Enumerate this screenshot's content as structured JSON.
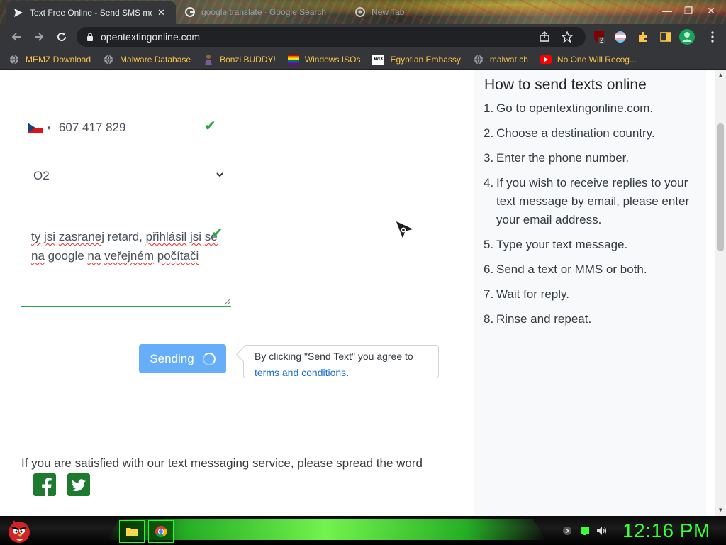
{
  "browser": {
    "tabs": [
      {
        "title": "Text Free Online - Send SMS me",
        "favicon": "paper-plane-icon",
        "active": true
      },
      {
        "title": "google translate - Google Search",
        "favicon": "google-icon",
        "active": false
      },
      {
        "title": "New Tab",
        "favicon": "chrome-icon",
        "active": false
      }
    ],
    "close_label": "✕",
    "url": "opentextingonline.com",
    "bookmarks": [
      {
        "label": "MEMZ Download",
        "icon": "globe-icon"
      },
      {
        "label": "Malware Database",
        "icon": "globe-icon"
      },
      {
        "label": "Bonzi BUDDY!",
        "icon": "bonzi-icon"
      },
      {
        "label": "Windows ISOs",
        "icon": "rainbow-flag-icon"
      },
      {
        "label": "Egyptian Embassy",
        "icon": "wix-icon"
      },
      {
        "label": "malwat.ch",
        "icon": "globe-icon"
      },
      {
        "label": "No One Will Recog...",
        "icon": "youtube-icon"
      }
    ],
    "extension_badge": "2",
    "wix_label": "WIX"
  },
  "form": {
    "country": "CZ",
    "phone": "607 417 829",
    "carrier": "O2",
    "message_words": [
      {
        "text": "ty",
        "spell": true
      },
      {
        "text": " ",
        "spell": false
      },
      {
        "text": "jsi",
        "spell": true
      },
      {
        "text": " ",
        "spell": false
      },
      {
        "text": "zasranej",
        "spell": true
      },
      {
        "text": " retard, ",
        "spell": false
      },
      {
        "text": "přihlásil",
        "spell": true
      },
      {
        "text": " ",
        "spell": false
      },
      {
        "text": "jsi",
        "spell": true
      },
      {
        "text": " ",
        "spell": false
      },
      {
        "text": "se",
        "spell": true
      },
      {
        "text": " ",
        "spell": false
      },
      {
        "text": "na",
        "spell": true
      },
      {
        "text": " google ",
        "spell": false
      },
      {
        "text": "na",
        "spell": true
      },
      {
        "text": " ",
        "spell": false
      },
      {
        "text": "veřejném",
        "spell": true
      },
      {
        "text": " ",
        "spell": false
      },
      {
        "text": "počítači",
        "spell": true
      }
    ],
    "send_label": "Sending",
    "terms_prefix": "By clicking \"Send Text\" you agree to",
    "terms_link": "terms and conditions",
    "terms_suffix": ".",
    "spread_text": "If you are satisfied with our text messaging service, please spread the word",
    "accent_color": "#28a745",
    "button_color": "#66aef9"
  },
  "sidebar": {
    "title": "How to send texts online",
    "steps": [
      {
        "num": "1.",
        "text": "Go to opentextingonline.com."
      },
      {
        "num": "2.",
        "text": "Choose a destination country."
      },
      {
        "num": "3.",
        "text": "Enter the phone number."
      },
      {
        "num": "4.",
        "text": "If you wish to receive replies to your text message by email, please enter your email address."
      },
      {
        "num": "5.",
        "text": "Type your text message."
      },
      {
        "num": "6.",
        "text": "Send a text or MMS or both."
      },
      {
        "num": "7.",
        "text": "Wait for reply."
      },
      {
        "num": "8.",
        "text": "Rinse and repeat."
      }
    ]
  },
  "taskbar": {
    "clock": "12:16 PM",
    "clock_color": "#3cff3c"
  }
}
